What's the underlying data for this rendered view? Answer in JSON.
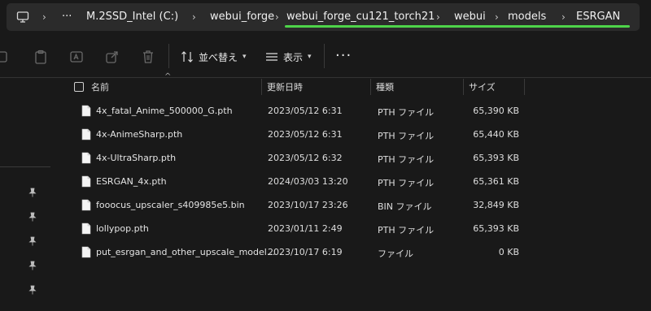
{
  "address_bar": {
    "overflow": "···",
    "crumbs": [
      "M.2SSD_Intel (C:)",
      "webui_forge",
      "webui_forge_cu121_torch21",
      "webui",
      "models",
      "ESRGAN"
    ],
    "highlight_color": "#4ed44a"
  },
  "toolbar": {
    "sort_label": "並べ替え",
    "view_label": "表示",
    "more_label": "···"
  },
  "columns": {
    "name": "名前",
    "date": "更新日時",
    "type": "種類",
    "size": "サイズ"
  },
  "files": [
    {
      "name": "4x_fatal_Anime_500000_G.pth",
      "date": "2023/05/12 6:31",
      "type": "PTH ファイル",
      "size": "65,390 KB"
    },
    {
      "name": "4x-AnimeSharp.pth",
      "date": "2023/05/12 6:31",
      "type": "PTH ファイル",
      "size": "65,440 KB"
    },
    {
      "name": "4x-UltraSharp.pth",
      "date": "2023/05/12 6:32",
      "type": "PTH ファイル",
      "size": "65,393 KB"
    },
    {
      "name": "ESRGAN_4x.pth",
      "date": "2024/03/03 13:20",
      "type": "PTH ファイル",
      "size": "65,361 KB"
    },
    {
      "name": "fooocus_upscaler_s409985e5.bin",
      "date": "2023/10/17 23:26",
      "type": "BIN ファイル",
      "size": "32,849 KB"
    },
    {
      "name": "lollypop.pth",
      "date": "2023/01/11 2:49",
      "type": "PTH ファイル",
      "size": "65,393 KB"
    },
    {
      "name": "put_esrgan_and_other_upscale_model...",
      "date": "2023/10/17 6:19",
      "type": "ファイル",
      "size": "0 KB"
    }
  ]
}
